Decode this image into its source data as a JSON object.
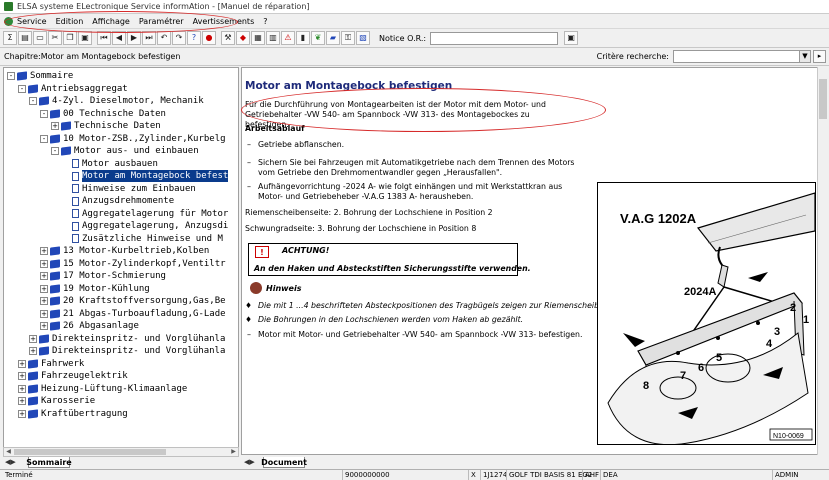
{
  "window": {
    "title": "ELSA systeme ELectronique Service informAtion - [Manuel de réparation]"
  },
  "menu": [
    {
      "label": "Service"
    },
    {
      "label": "Edition"
    },
    {
      "label": "Affichage"
    },
    {
      "label": "Paramétrer"
    },
    {
      "label": "Avertissements"
    },
    {
      "label": "?"
    }
  ],
  "toolbar": {
    "notice_label": "Notice O.R.:",
    "notice_value": ""
  },
  "chapter": {
    "label": "Chapitre:Motor am Montagebock befestigen",
    "search_label": "Critère recherche:",
    "search_value": ""
  },
  "tree": {
    "items": [
      {
        "label": "Sommaire",
        "level": 0,
        "expander": "-",
        "icon": "book"
      },
      {
        "label": "Antriebsaggregat",
        "level": 1,
        "expander": "-",
        "icon": "book"
      },
      {
        "label": "4-Zyl. Dieselmotor, Mechanik",
        "level": 2,
        "expander": "-",
        "icon": "book"
      },
      {
        "label": "00 Technische Daten",
        "level": 3,
        "expander": "-",
        "icon": "book"
      },
      {
        "label": "Technische Daten",
        "level": 4,
        "expander": "+",
        "icon": "book"
      },
      {
        "label": "10 Motor-ZSB.,Zylinder,Kurbelg",
        "level": 3,
        "expander": "-",
        "icon": "book"
      },
      {
        "label": "Motor aus- und einbauen",
        "level": 4,
        "expander": "-",
        "icon": "book"
      },
      {
        "label": "Motor ausbauen",
        "level": 5,
        "expander": "",
        "icon": "doc"
      },
      {
        "label": "Motor am Montagebock befest",
        "level": 5,
        "expander": "",
        "icon": "doc",
        "selected": true
      },
      {
        "label": "Hinweise zum Einbauen",
        "level": 5,
        "expander": "",
        "icon": "doc"
      },
      {
        "label": "Anzugsdrehmomente",
        "level": 5,
        "expander": "",
        "icon": "doc"
      },
      {
        "label": "Aggregatelagerung für Motor",
        "level": 5,
        "expander": "",
        "icon": "doc"
      },
      {
        "label": "Aggregatelagerung, Anzugsdi",
        "level": 5,
        "expander": "",
        "icon": "doc"
      },
      {
        "label": "Zusätzliche Hinweise und M",
        "level": 5,
        "expander": "",
        "icon": "doc"
      },
      {
        "label": "13 Motor-Kurbeltrieb,Kolben",
        "level": 3,
        "expander": "+",
        "icon": "book"
      },
      {
        "label": "15 Motor-Zylinderkopf,Ventiltr",
        "level": 3,
        "expander": "+",
        "icon": "book"
      },
      {
        "label": "17 Motor-Schmierung",
        "level": 3,
        "expander": "+",
        "icon": "book"
      },
      {
        "label": "19 Motor-Kühlung",
        "level": 3,
        "expander": "+",
        "icon": "book"
      },
      {
        "label": "20 Kraftstoffversorgung,Gas,Be",
        "level": 3,
        "expander": "+",
        "icon": "book"
      },
      {
        "label": "21 Abgas-Turboaufladung,G-Lade",
        "level": 3,
        "expander": "+",
        "icon": "book"
      },
      {
        "label": "26 Abgasanlage",
        "level": 3,
        "expander": "+",
        "icon": "book"
      },
      {
        "label": "Direkteinspritz- und Vorglühanla",
        "level": 2,
        "expander": "+",
        "icon": "book"
      },
      {
        "label": "Direkteinspritz- und Vorglühanla",
        "level": 2,
        "expander": "+",
        "icon": "book"
      },
      {
        "label": "Fahrwerk",
        "level": 1,
        "expander": "+",
        "icon": "book"
      },
      {
        "label": "Fahrzeugelektrik",
        "level": 1,
        "expander": "+",
        "icon": "book"
      },
      {
        "label": "Heizung-Lüftung-Klimaanlage",
        "level": 1,
        "expander": "+",
        "icon": "book"
      },
      {
        "label": "Karosserie",
        "level": 1,
        "expander": "+",
        "icon": "book"
      },
      {
        "label": "Kraftübertragung",
        "level": 1,
        "expander": "+",
        "icon": "book"
      }
    ]
  },
  "tabs": {
    "left": "Sommaire",
    "right": "Document"
  },
  "document": {
    "title": "Motor am Montagebock befestigen",
    "intro": "Für die Durchführung von Montagearbeiten ist der Motor mit dem Motor- und Getriebehalter -VW 540- am Spannbock -VW 313- des Montagebockes zu befestigen.",
    "section": "Arbeitsablauf",
    "steps": [
      "Getriebe abflanschen.",
      "Sichern Sie bei Fahrzeugen mit Automatikgetriebe nach dem Trennen des Motors vom Getriebe den Drehmomentwandler gegen „Herausfallen\".",
      "Aufhängevorrichtung -2024 A- wie folgt einhängen und mit Werkstattkran aus Motor- und Getriebeheber -V.A.G 1383 A- herausheben."
    ],
    "riemen": "Riemenscheibenseite: 2. Bohrung der Lochschiene in Position 2",
    "schwung": "Schwungradseite: 3. Bohrung der Lochschiene in Position 8",
    "warning_title": "ACHTUNG!",
    "warning_body": "An den Haken und Absteckstiften Sicherungsstifte verwenden.",
    "note_title": "Hinweis",
    "notes": [
      "Die mit 1 ...4 beschrifteten Absteckpositionen des Tragbügels zeigen zur Riemenscheibe.",
      "Die Bohrungen in den Lochschienen werden vom Haken ab gezählt."
    ],
    "final_step": "Motor mit Motor- und Getriebehalter -VW 540- am Spannbock -VW 313- befestigen.",
    "figure": {
      "label_crane": "V.A.G 1202A",
      "label_tool": "2024A",
      "ref": "N10-0069",
      "numbers": [
        "1",
        "2",
        "3",
        "4",
        "5",
        "6",
        "7",
        "8"
      ]
    }
  },
  "status": {
    "left": "Terminé",
    "code": "9000000000",
    "c3": "X",
    "c4": "1J1274",
    "c5": "GOLF TDI BASIS 81 EG2",
    "c6": "AHF",
    "c7": "DEA",
    "user": "ADMIN"
  },
  "colors": {
    "selected": "#0a3b8c",
    "title_blue": "#1e2a7a",
    "book_blue": "#2147b8",
    "annotation_red": "#d62b2b"
  }
}
